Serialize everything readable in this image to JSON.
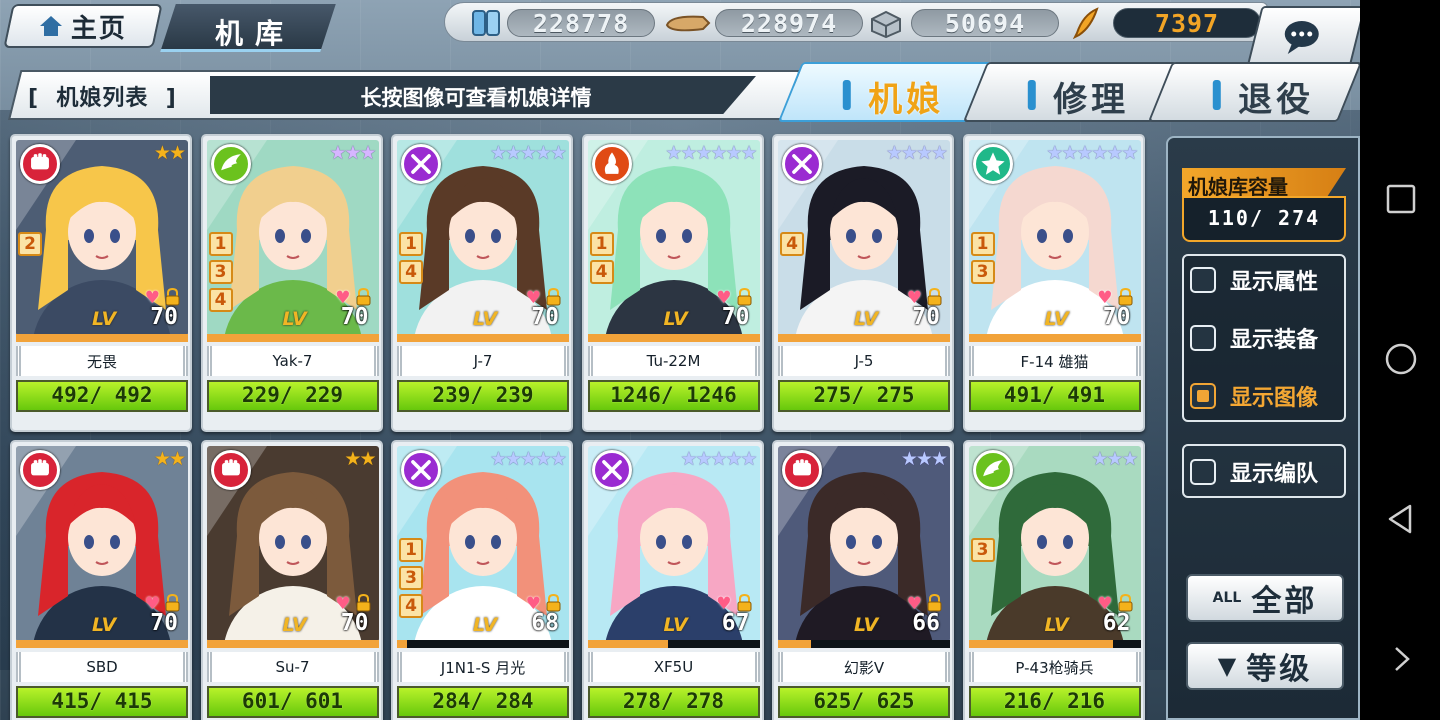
{
  "header": {
    "home_label": "主页",
    "screen_title": "机库"
  },
  "resources": [
    {
      "icon": "fuel-icon",
      "value": "228778"
    },
    {
      "icon": "ammo-icon",
      "value": "228974"
    },
    {
      "icon": "steel-icon",
      "value": "50694"
    },
    {
      "icon": "gold-feather-icon",
      "value": "7397"
    }
  ],
  "list_header": {
    "label": "[  机娘列表  ]",
    "hint": "长按图像可查看机娘详情"
  },
  "tabs": [
    {
      "label": "机娘",
      "active": true
    },
    {
      "label": "修理",
      "active": false
    },
    {
      "label": "退役",
      "active": false
    }
  ],
  "cards": [
    {
      "name": "无畏",
      "type": "fist",
      "stars": "★★",
      "star_style": "gold",
      "chips": [
        "2"
      ],
      "lv_tag": "LV",
      "level": "70",
      "xp": 1.0,
      "hp": "492/ 492",
      "hp_ratio": 1.0,
      "palette": [
        "#f7c64a",
        "#3b4a63",
        "#4d5d74"
      ]
    },
    {
      "name": "Yak-7",
      "type": "wing",
      "stars": "★★★",
      "star_style": "purple",
      "chips": [
        "1",
        "3",
        "4"
      ],
      "lv_tag": "LV",
      "level": "70",
      "xp": 1.0,
      "hp": "229/ 229",
      "hp_ratio": 1.0,
      "palette": [
        "#f1cf8e",
        "#6bb94a",
        "#9fd9c3"
      ]
    },
    {
      "name": "J-7",
      "type": "cross",
      "stars": "★★★★★",
      "star_style": "rainbow",
      "chips": [
        "1",
        "4"
      ],
      "lv_tag": "LV",
      "level": "70",
      "xp": 1.0,
      "hp": "239/ 239",
      "hp_ratio": 1.0,
      "palette": [
        "#5a3a27",
        "#f2f2f2",
        "#9fe0dd"
      ]
    },
    {
      "name": "Tu-22M",
      "type": "flame",
      "stars": "★★★★★★",
      "star_style": "rainbow",
      "chips": [
        "1",
        "4"
      ],
      "lv_tag": "LV",
      "level": "70",
      "xp": 1.0,
      "hp": "1246/ 1246",
      "hp_ratio": 1.0,
      "palette": [
        "#8de2b9",
        "#2c3542",
        "#bfeee0"
      ]
    },
    {
      "name": "J-5",
      "type": "cross",
      "stars": "★★★★",
      "star_style": "rainbow",
      "chips": [
        "4"
      ],
      "lv_tag": "LV",
      "level": "70",
      "xp": 1.0,
      "hp": "275/ 275",
      "hp_ratio": 1.0,
      "palette": [
        "#1b1b26",
        "#f4f4f4",
        "#c9dde8"
      ]
    },
    {
      "name": "F-14 雄猫",
      "type": "star",
      "stars": "★★★★★★",
      "star_style": "rainbow",
      "chips": [
        "1",
        "3"
      ],
      "lv_tag": "LV",
      "level": "70",
      "xp": 1.0,
      "hp": "491/ 491",
      "hp_ratio": 1.0,
      "palette": [
        "#f5d8d0",
        "#ffffff",
        "#bfe4f0"
      ]
    },
    {
      "name": "SBD",
      "type": "fist",
      "stars": "★★",
      "star_style": "gold",
      "chips": [],
      "lv_tag": "LV",
      "level": "70",
      "xp": 1.0,
      "hp": "415/ 415",
      "hp_ratio": 1.0,
      "palette": [
        "#d9252b",
        "#233247",
        "#6f8296"
      ]
    },
    {
      "name": "Su-7",
      "type": "fist",
      "stars": "★★",
      "star_style": "gold",
      "chips": [],
      "lv_tag": "LV",
      "level": "70",
      "xp": 1.0,
      "hp": "601/ 601",
      "hp_ratio": 1.0,
      "palette": [
        "#7c5a3c",
        "#f5f1e8",
        "#4a3b30"
      ]
    },
    {
      "name": "J1N1-S 月光",
      "type": "cross",
      "stars": "★★★★★",
      "star_style": "rainbow",
      "chips": [
        "1",
        "3",
        "4"
      ],
      "lv_tag": "LV",
      "level": "68",
      "xp": 0.06,
      "hp": "284/ 284",
      "hp_ratio": 1.0,
      "palette": [
        "#f2917a",
        "#ffffff",
        "#a8e4ef"
      ]
    },
    {
      "name": "XF5U",
      "type": "cross",
      "stars": "★★★★★",
      "star_style": "rainbow",
      "chips": [],
      "lv_tag": "LV",
      "level": "67",
      "xp": 0.47,
      "hp": "278/ 278",
      "hp_ratio": 1.0,
      "palette": [
        "#f7a7c4",
        "#2b3f6a",
        "#b8e9f4"
      ]
    },
    {
      "name": "幻影V",
      "type": "fist",
      "stars": "★★★",
      "star_style": "rainbow",
      "chips": [],
      "lv_tag": "LV",
      "level": "66",
      "xp": 0.19,
      "hp": "625/ 625",
      "hp_ratio": 1.0,
      "palette": [
        "#3b2a28",
        "#1f1a24",
        "#4f5a7a"
      ]
    },
    {
      "name": "P-43枪骑兵",
      "type": "wing",
      "stars": "★★★",
      "star_style": "rainbow",
      "chips": [
        "3"
      ],
      "lv_tag": "LV",
      "level": "62",
      "xp": 0.84,
      "hp": "216/ 216",
      "hp_ratio": 1.0,
      "palette": [
        "#2f6a3a",
        "#4a3a2a",
        "#a9dac0"
      ]
    }
  ],
  "side_panel": {
    "capacity_label": "机娘库容量",
    "capacity_value": "110/ 274",
    "options": [
      {
        "label": "显示属性",
        "checked": false
      },
      {
        "label": "显示装备",
        "checked": false
      },
      {
        "label": "显示图像",
        "checked": true
      }
    ],
    "team_option": {
      "label": "显示编队",
      "checked": false
    },
    "filter_all_small": "ALL",
    "filter_all_label": "全部",
    "sort_label": "等级"
  },
  "colors": {
    "accent": "#f0a316",
    "tab_active_bg": "#bfe5fa",
    "hp_green": "#8ee11c",
    "panel_bg": "#1c2a36"
  }
}
